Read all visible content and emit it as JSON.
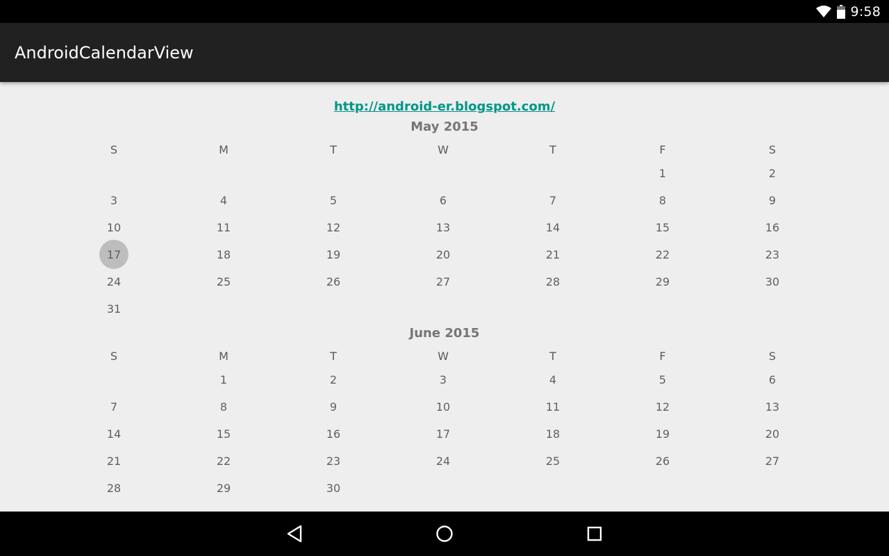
{
  "status_bar": {
    "time": "9:58",
    "icons": [
      "wifi-icon",
      "battery-icon"
    ]
  },
  "app_bar": {
    "title": "AndroidCalendarView"
  },
  "link": {
    "text": "http://android-er.blogspot.com/"
  },
  "calendar": {
    "day_headers": [
      "S",
      "M",
      "T",
      "W",
      "T",
      "F",
      "S"
    ],
    "selected_date": {
      "month_index": 0,
      "day": "17"
    },
    "months": [
      {
        "title": "May 2015",
        "weeks": [
          [
            "",
            "",
            "",
            "",
            "",
            "1",
            "2"
          ],
          [
            "3",
            "4",
            "5",
            "6",
            "7",
            "8",
            "9"
          ],
          [
            "10",
            "11",
            "12",
            "13",
            "14",
            "15",
            "16"
          ],
          [
            "17",
            "18",
            "19",
            "20",
            "21",
            "22",
            "23"
          ],
          [
            "24",
            "25",
            "26",
            "27",
            "28",
            "29",
            "30"
          ],
          [
            "31",
            "",
            "",
            "",
            "",
            "",
            ""
          ]
        ]
      },
      {
        "title": "June 2015",
        "weeks": [
          [
            "",
            "1",
            "2",
            "3",
            "4",
            "5",
            "6"
          ],
          [
            "7",
            "8",
            "9",
            "10",
            "11",
            "12",
            "13"
          ],
          [
            "14",
            "15",
            "16",
            "17",
            "18",
            "19",
            "20"
          ],
          [
            "21",
            "22",
            "23",
            "24",
            "25",
            "26",
            "27"
          ],
          [
            "28",
            "29",
            "30",
            "",
            "",
            "",
            ""
          ]
        ]
      }
    ]
  },
  "nav_bar": {
    "buttons": [
      "back-icon",
      "home-icon",
      "recents-icon"
    ]
  },
  "colors": {
    "link": "#009688",
    "app_bar": "#212121",
    "background": "#eeeeee",
    "selected_day": "#bdbdbd"
  }
}
